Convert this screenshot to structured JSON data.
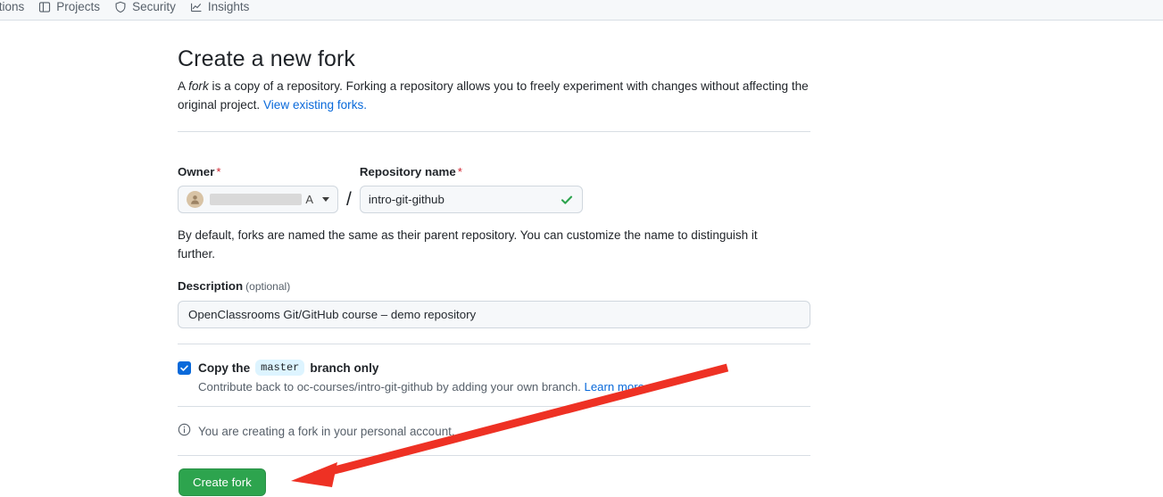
{
  "repo_nav": {
    "items": [
      {
        "label": "ctions",
        "icon": "play-circle-icon"
      },
      {
        "label": "Projects",
        "icon": "table-icon"
      },
      {
        "label": "Security",
        "icon": "shield-icon"
      },
      {
        "label": "Insights",
        "icon": "graph-icon"
      }
    ]
  },
  "page": {
    "title": "Create a new fork",
    "desc_prefix": "A ",
    "desc_em": "fork",
    "desc_mid": " is a copy of a repository. Forking a repository allows you to freely experiment with changes without affecting the original project. ",
    "desc_link": "View existing forks."
  },
  "owner": {
    "label": "Owner",
    "required_mark": "*",
    "avatar_icon": "user-avatar-icon",
    "name_visible_tail": "A",
    "caret_icon": "chevron-down-icon",
    "separator": "/"
  },
  "repository": {
    "label": "Repository name",
    "required_mark": "*",
    "value": "intro-git-github",
    "valid_icon": "check-icon"
  },
  "hint": "By default, forks are named the same as their parent repository. You can customize the name to distinguish it further.",
  "description": {
    "label": "Description",
    "optional": "(optional)",
    "value": "OpenClassrooms Git/GitHub course – demo repository"
  },
  "copy_branch": {
    "checked": true,
    "check_icon": "checkmark-icon",
    "label_before": "Copy the",
    "branch_name": "master",
    "label_after": "branch only",
    "sub_text": "Contribute back to oc-courses/intro-git-github by adding your own branch.",
    "learn_more": "Learn more."
  },
  "notice": {
    "icon": "info-icon",
    "text": "You are creating a fork in your personal account."
  },
  "create_button": {
    "label": "Create fork"
  },
  "annotation": {
    "arrow_color": "#EE3124",
    "arrow_icon": "red-arrow-pointer"
  },
  "colors": {
    "accent_link": "#0969da",
    "success_green": "#2da44e",
    "required_red": "#cf222e",
    "nav_bg": "#f6f8fa",
    "border": "#d0d7de"
  }
}
